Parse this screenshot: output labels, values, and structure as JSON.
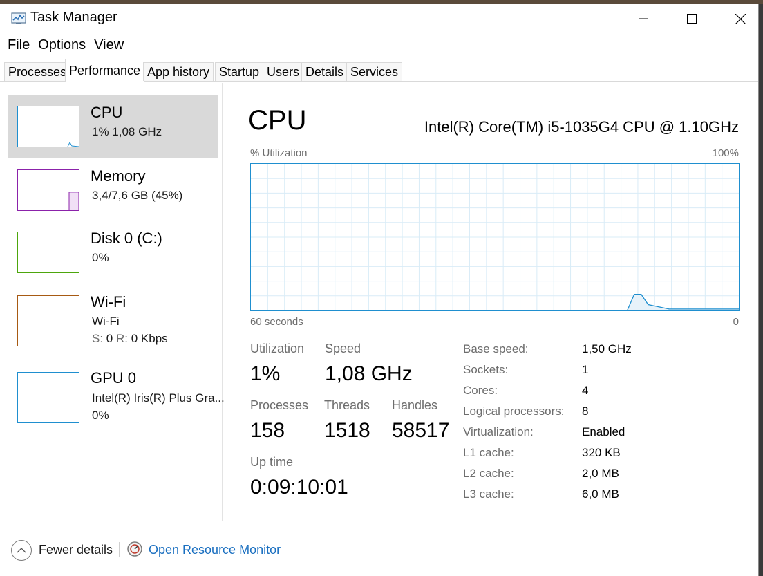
{
  "window": {
    "title": "Task Manager"
  },
  "menu": [
    "File",
    "Options",
    "View"
  ],
  "tabs": [
    "Processes",
    "Performance",
    "App history",
    "Startup",
    "Users",
    "Details",
    "Services"
  ],
  "active_tab": "Performance",
  "sidebar": [
    {
      "name": "CPU",
      "detail": "1%  1,08 GHz",
      "color": "#1f8fcf"
    },
    {
      "name": "Memory",
      "detail": "3,4/7,6 GB (45%)",
      "color": "#8b22aa"
    },
    {
      "name": "Disk 0 (C:)",
      "detail": "0%",
      "color": "#4da60c"
    },
    {
      "name": "Wi-Fi",
      "detail": "Wi-Fi",
      "detail2_s": "S:",
      "detail2_s_val": "0",
      "detail2_r": "R:",
      "detail2_r_val": "0 Kbps",
      "color": "#a75a13"
    },
    {
      "name": "GPU 0",
      "detail": "Intel(R) Iris(R) Plus Gra...",
      "detail2": "0%",
      "color": "#1f8fcf"
    }
  ],
  "main": {
    "title": "CPU",
    "model": "Intel(R) Core(TM) i5-1035G4 CPU @ 1.10GHz",
    "graph": {
      "top_left": "% Utilization",
      "top_right": "100%",
      "bottom_left": "60 seconds",
      "bottom_right": "0",
      "series_pct": [
        0,
        0,
        0,
        0,
        0,
        0,
        0,
        0,
        0,
        0,
        0,
        0,
        0,
        0,
        0,
        0,
        0,
        0,
        0,
        0,
        0,
        0,
        0,
        0,
        0,
        0,
        0,
        0,
        0,
        0,
        0,
        0,
        0,
        0,
        0,
        0,
        0,
        0,
        0,
        0,
        0,
        0,
        0,
        0,
        0,
        0,
        0,
        0,
        0,
        0,
        0,
        0,
        0,
        0,
        0,
        11,
        11,
        4,
        3,
        2,
        1,
        1,
        1,
        1,
        1,
        1,
        1,
        1,
        1,
        1,
        1
      ]
    },
    "stats": {
      "utilization_label": "Utilization",
      "utilization": "1%",
      "speed_label": "Speed",
      "speed": "1,08 GHz",
      "processes_label": "Processes",
      "processes": "158",
      "threads_label": "Threads",
      "threads": "1518",
      "handles_label": "Handles",
      "handles": "58517",
      "uptime_label": "Up time",
      "uptime": "0:09:10:01"
    },
    "specs": [
      {
        "label": "Base speed:",
        "value": "1,50 GHz"
      },
      {
        "label": "Sockets:",
        "value": "1"
      },
      {
        "label": "Cores:",
        "value": "4"
      },
      {
        "label": "Logical processors:",
        "value": "8"
      },
      {
        "label": "Virtualization:",
        "value": "Enabled"
      },
      {
        "label": "L1 cache:",
        "value": "320 KB"
      },
      {
        "label": "L2 cache:",
        "value": "2,0 MB"
      },
      {
        "label": "L3 cache:",
        "value": "6,0 MB"
      }
    ]
  },
  "footer": {
    "fewer_details": "Fewer details",
    "resource_monitor": "Open Resource Monitor"
  },
  "colors": {
    "accent": "#1f8fcf",
    "link": "#1a6fc0",
    "selected_bg": "#d9d9d9",
    "memory_fill_pct": 45
  }
}
